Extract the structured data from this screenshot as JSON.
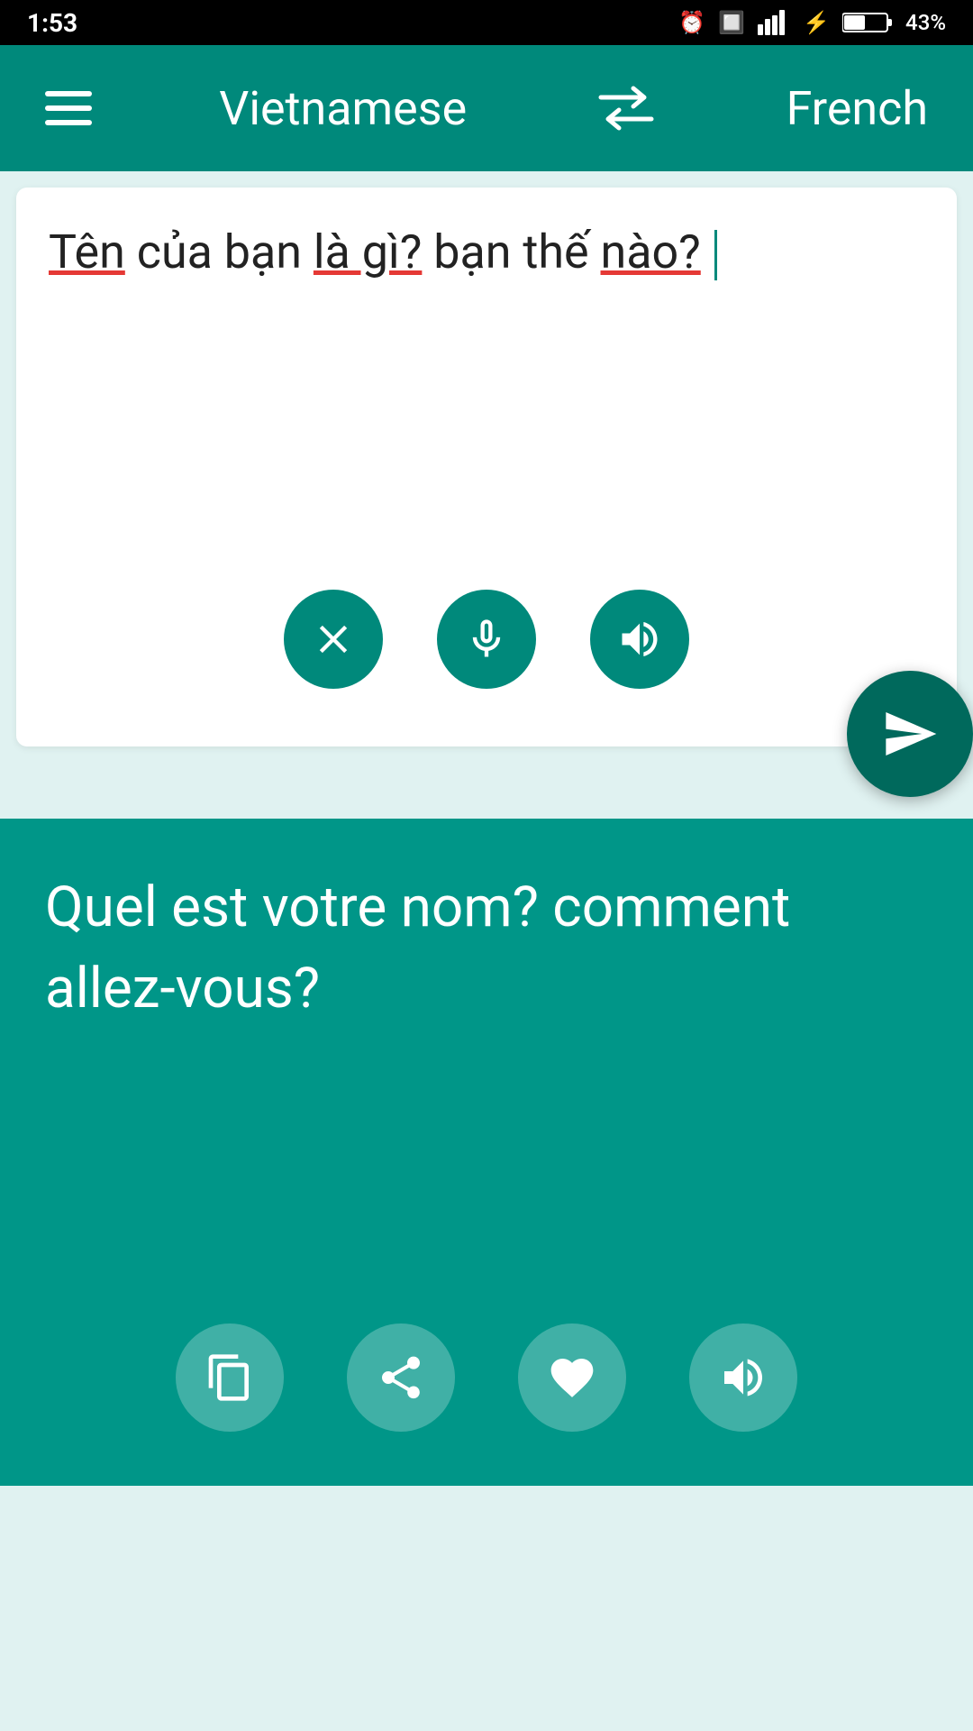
{
  "status_bar": {
    "time": "1:53",
    "battery": "43%"
  },
  "top_bar": {
    "source_lang": "Vietnamese",
    "target_lang": "French",
    "swap_label": "swap languages"
  },
  "source_panel": {
    "input_text": "Tên của bạn là gì? bạn thế nào?",
    "underlined_words": [
      "Tên",
      "là gì?",
      "nào?"
    ],
    "clear_button_label": "Clear",
    "mic_button_label": "Microphone",
    "speak_button_label": "Speak source"
  },
  "translate_fab": {
    "label": "Translate"
  },
  "result_panel": {
    "translated_text": "Quel est votre nom? comment allez-vous?",
    "copy_button_label": "Copy",
    "share_button_label": "Share",
    "favorite_button_label": "Favorite",
    "speak_button_label": "Speak translation"
  }
}
